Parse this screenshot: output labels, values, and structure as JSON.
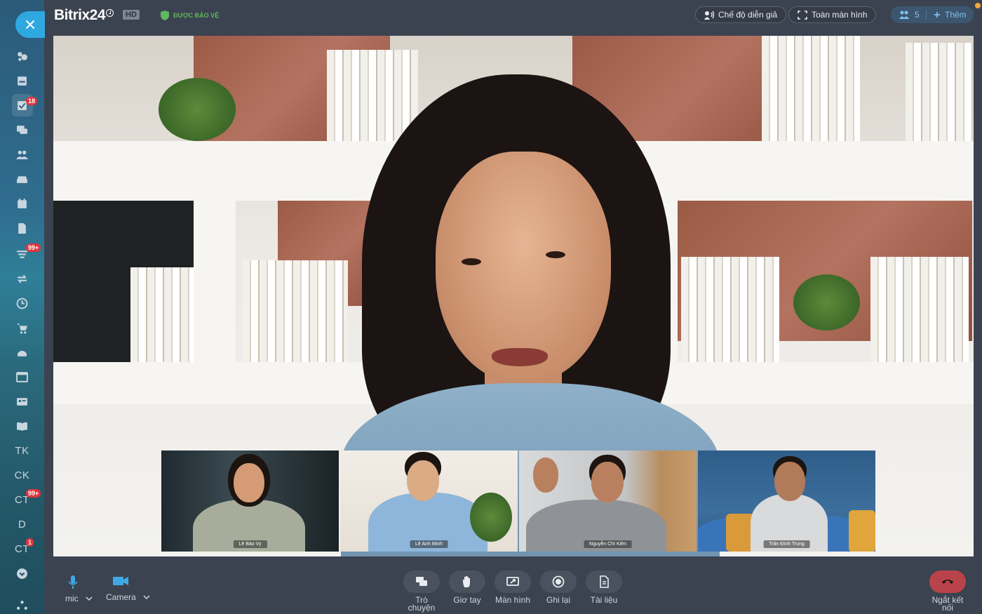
{
  "topbar": {
    "logo": "Bitrix24",
    "hd_badge": "HD",
    "protected_label": "ĐƯỢC BẢO VỆ",
    "speaker_mode_label": "Chế độ diễn giả",
    "fullscreen_label": "Toàn màn hình",
    "participants_count": "5",
    "add_label": "Thêm"
  },
  "sidebar": {
    "badges": {
      "tasks": "18",
      "filter": "99+",
      "ct1": "99+",
      "ct2": "1"
    },
    "text_items": [
      "TK",
      "CK",
      "CT",
      "D",
      "CT"
    ]
  },
  "participants": [
    {
      "name": "Lê Bảo Vy"
    },
    {
      "name": "Lê Anh Minh"
    },
    {
      "name": "Nguyễn Chí Kiên"
    },
    {
      "name": "Trần Đình Trung"
    }
  ],
  "controls": {
    "mic_label": "mic",
    "camera_label": "Camera",
    "chat_label": "Trò chuyện",
    "raise_hand_label": "Giơ tay",
    "screen_label": "Màn hình",
    "record_label": "Ghi lại",
    "documents_label": "Tài liệu",
    "disconnect_label": "Ngắt kết nối"
  },
  "colors": {
    "background": "#3b4350",
    "accent": "#2fa8e0",
    "hangup": "#b9434a",
    "badge": "#e2343a"
  }
}
